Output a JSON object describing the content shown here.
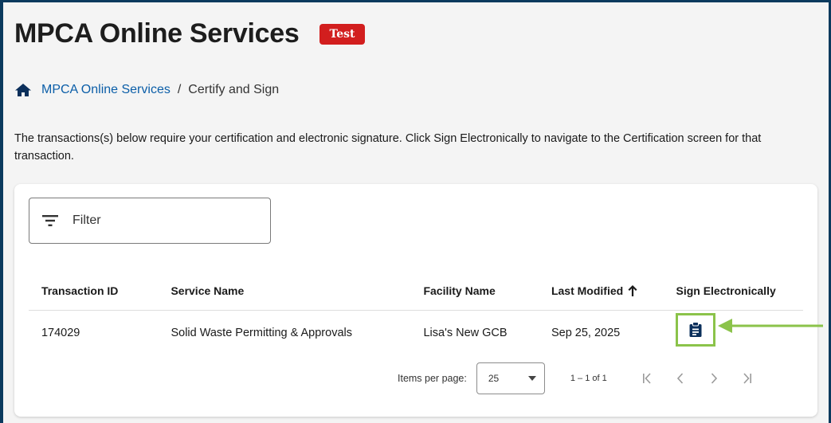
{
  "header": {
    "app_title": "MPCA Online Services",
    "env_badge": "Test"
  },
  "breadcrumb": {
    "home_link": "MPCA Online Services",
    "separator": "/",
    "current": "Certify and Sign"
  },
  "intro_text": "The transactions(s) below require your certification and electronic signature. Click Sign Electronically to navigate to the Certification screen for that transaction.",
  "filter": {
    "label": "Filter",
    "icon": "filter-list-icon"
  },
  "table": {
    "columns": {
      "transaction_id": "Transaction ID",
      "service_name": "Service Name",
      "facility_name": "Facility Name",
      "last_modified": "Last Modified",
      "sign_electronically": "Sign Electronically"
    },
    "sort": {
      "column": "Last Modified",
      "direction": "ascending"
    },
    "rows": [
      {
        "transaction_id": "174029",
        "service_name": "Solid Waste Permitting & Approvals",
        "facility_name": "Lisa's New GCB",
        "last_modified": "Sep 25, 2025",
        "sign_icon": "clipboard-icon"
      }
    ]
  },
  "paginator": {
    "items_per_page_label": "Items per page:",
    "items_per_page_value": "25",
    "range_label": "1 – 1 of 1"
  },
  "colors": {
    "header_border": "#0b3a5e",
    "badge_red": "#d21e1e",
    "link_blue": "#0b5ea8",
    "highlight_green": "#8bc34a",
    "icon_navy": "#0b2f5b"
  }
}
